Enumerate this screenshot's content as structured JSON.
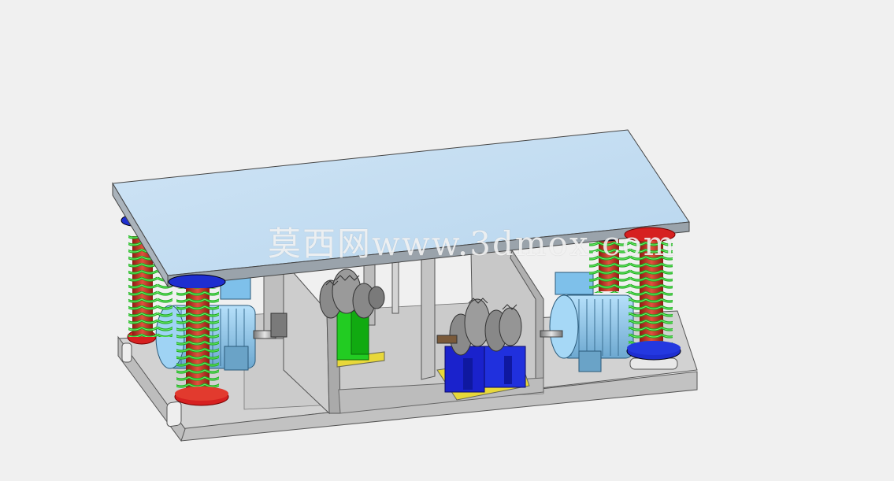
{
  "watermark": {
    "text": "莫西网www.3dmox.com"
  },
  "colors": {
    "background": "#f0f0f0",
    "top_plate": "#c5ddf0",
    "spring": "#2fd12f",
    "spring_core": "#c0392b",
    "spring_cap": "#2233cc",
    "base_frame": "#d0d0d0",
    "motor_body": "#8fc8ee",
    "gearbox_green": "#22cc22",
    "gearbox_blue": "#1a22cc",
    "gearbox_base": "#e8d83a"
  },
  "objects": {
    "name": "vibrating-table-assembly",
    "parts": [
      "top-plate",
      "coil-springs",
      "electric-motors",
      "gear-exciters",
      "base-frame"
    ]
  }
}
